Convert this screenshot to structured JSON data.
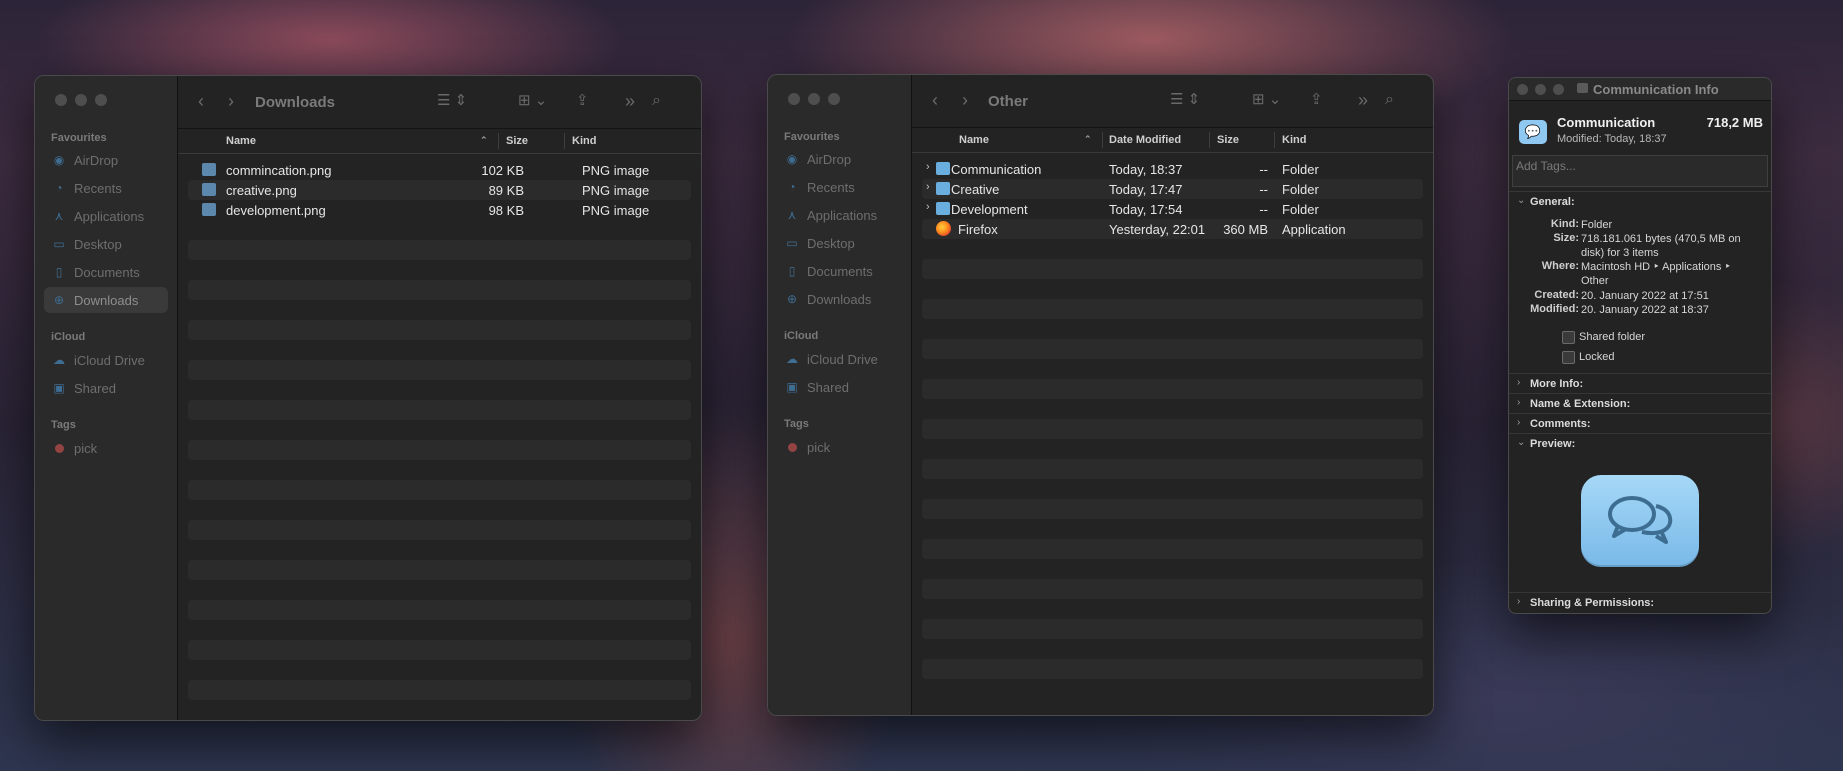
{
  "window1": {
    "title": "Downloads",
    "sidebar": {
      "favourites_header": "Favourites",
      "items": [
        {
          "label": "AirDrop",
          "icon": "airdrop-icon"
        },
        {
          "label": "Recents",
          "icon": "clock-icon"
        },
        {
          "label": "Applications",
          "icon": "applications-icon"
        },
        {
          "label": "Desktop",
          "icon": "desktop-icon"
        },
        {
          "label": "Documents",
          "icon": "document-icon"
        },
        {
          "label": "Downloads",
          "icon": "download-icon"
        }
      ],
      "icloud_header": "iCloud",
      "icloud_items": [
        {
          "label": "iCloud Drive",
          "icon": "cloud-icon"
        },
        {
          "label": "Shared",
          "icon": "shared-folder-icon"
        }
      ],
      "tags_header": "Tags",
      "tags": [
        {
          "label": "pick",
          "color": "#c0504d"
        }
      ]
    },
    "columns": {
      "name": "Name",
      "size": "Size",
      "kind": "Kind"
    },
    "rows": [
      {
        "name": "commincation.png",
        "size": "102 KB",
        "kind": "PNG image"
      },
      {
        "name": "creative.png",
        "size": "89 KB",
        "kind": "PNG image"
      },
      {
        "name": "development.png",
        "size": "98 KB",
        "kind": "PNG image"
      }
    ]
  },
  "window2": {
    "title": "Other",
    "sidebar": {
      "favourites_header": "Favourites",
      "items": [
        {
          "label": "AirDrop",
          "icon": "airdrop-icon"
        },
        {
          "label": "Recents",
          "icon": "clock-icon"
        },
        {
          "label": "Applications",
          "icon": "applications-icon"
        },
        {
          "label": "Desktop",
          "icon": "desktop-icon"
        },
        {
          "label": "Documents",
          "icon": "document-icon"
        },
        {
          "label": "Downloads",
          "icon": "download-icon"
        }
      ],
      "icloud_header": "iCloud",
      "icloud_items": [
        {
          "label": "iCloud Drive",
          "icon": "cloud-icon"
        },
        {
          "label": "Shared",
          "icon": "shared-folder-icon"
        }
      ],
      "tags_header": "Tags",
      "tags": [
        {
          "label": "pick",
          "color": "#c0504d"
        }
      ]
    },
    "columns": {
      "name": "Name",
      "date": "Date Modified",
      "size": "Size",
      "kind": "Kind"
    },
    "rows": [
      {
        "name": "Communication",
        "date": "Today, 18:37",
        "size": "--",
        "kind": "Folder",
        "icon": "folder-communication-icon"
      },
      {
        "name": "Creative",
        "date": "Today, 17:47",
        "size": "--",
        "kind": "Folder",
        "icon": "folder-creative-icon"
      },
      {
        "name": "Development",
        "date": "Today, 17:54",
        "size": "--",
        "kind": "Folder",
        "icon": "folder-development-icon"
      },
      {
        "name": "Firefox",
        "date": "Yesterday, 22:01",
        "size": "360 MB",
        "kind": "Application",
        "icon": "firefox-icon"
      }
    ]
  },
  "info": {
    "title": "Communication Info",
    "name": "Communication",
    "size_short": "718,2 MB",
    "modified_line": "Modified: Today, 18:37",
    "tags_placeholder": "Add Tags...",
    "general_label": "General:",
    "kind_label": "Kind:",
    "kind_value": "Folder",
    "size_label": "Size:",
    "size_value_1": "718.181.061 bytes (470,5 MB on",
    "size_value_2": "disk) for 3 items",
    "where_label": "Where:",
    "where_value_1": "Macintosh HD ‣ Applications ‣",
    "where_value_2": "Other",
    "created_label": "Created:",
    "created_value": "20. January 2022 at 17:51",
    "modified_label": "Modified:",
    "modified_value": "20. January 2022 at 18:37",
    "shared_folder_label": "Shared folder",
    "locked_label": "Locked",
    "sections": {
      "more_info": "More Info:",
      "name_ext": "Name & Extension:",
      "comments": "Comments:",
      "preview": "Preview:",
      "sharing": "Sharing & Permissions:"
    }
  },
  "colors": {
    "accent": "#3f6d92",
    "folder_blue": "#6aaee0",
    "tag_red": "#c0504d"
  }
}
